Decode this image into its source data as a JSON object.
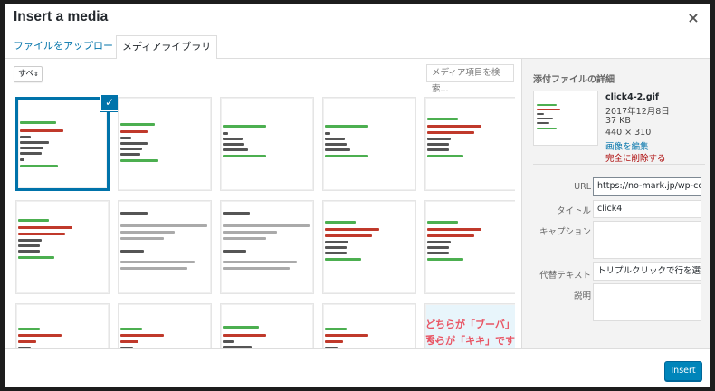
{
  "modal": {
    "title": "Insert a media",
    "close_label": "×"
  },
  "tabs": [
    {
      "label": "ファイルをアップロード"
    },
    {
      "label": "メディアライブラリ"
    }
  ],
  "toolbar": {
    "filter_value": "すべ",
    "search_placeholder": "メディア項目を検索..."
  },
  "grid": {
    "selected_index": 0,
    "check_icon": "checkmark-icon",
    "tile_text": [
      "どちらが「ブーバ」で、",
      "ちらが「キキ」ですか"
    ]
  },
  "sidebar": {
    "title": "添付ファイルの詳細",
    "file_name": "click4-2.gif",
    "date": "2017年12月8日",
    "size": "37 KB",
    "dimensions": "440 × 310",
    "edit_link": "画像を編集",
    "delete_link": "完全に削除する",
    "fields": {
      "url_label": "URL",
      "url_value": "https://no-mark.jp/wp-cont",
      "title_label": "タイトル",
      "title_value": "click4",
      "caption_label": "キャプション",
      "alt_label": "代替テキスト",
      "alt_value": "トリプルクリックで行を選択",
      "desc_label": "説明"
    }
  },
  "footer": {
    "insert_label": "Insert"
  },
  "colors": {
    "accent": "#0073aa",
    "button": "#0085ba",
    "delete": "#aa0000"
  }
}
